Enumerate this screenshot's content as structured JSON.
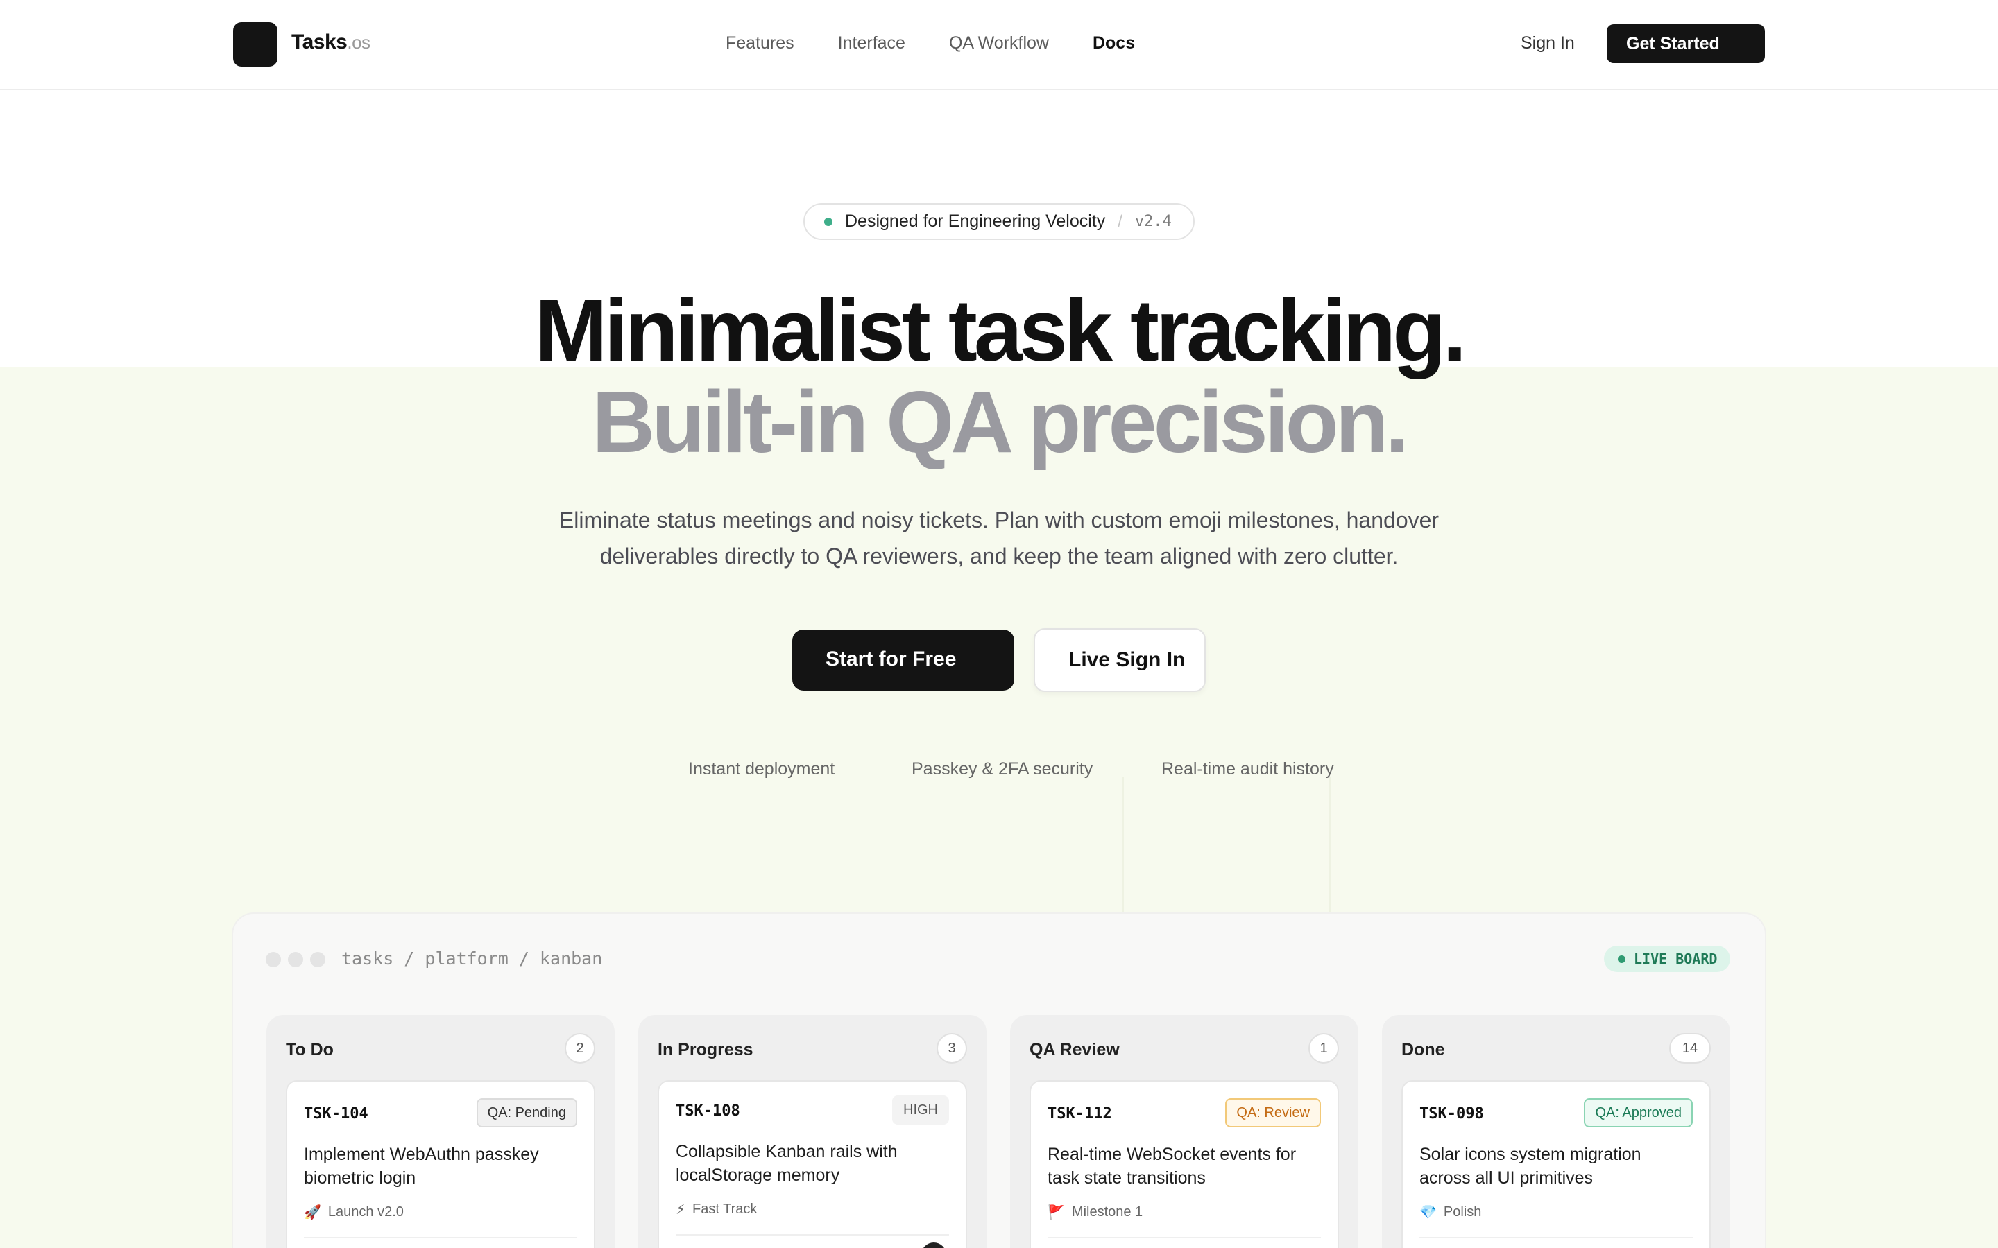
{
  "brand": {
    "name": "Tasks",
    "suffix": ".os"
  },
  "nav": {
    "links": [
      "Features",
      "Interface",
      "QA Workflow",
      "Docs"
    ],
    "active": "Docs",
    "signin": "Sign In",
    "cta": "Get Started"
  },
  "hero": {
    "pill_label": "Designed for Engineering Velocity",
    "pill_separator": "/",
    "pill_version": "v2.4",
    "headline_1": "Minimalist task tracking.",
    "headline_2": "Built-in QA precision.",
    "subtitle": "Eliminate status meetings and noisy tickets. Plan with custom emoji milestones, handover deliverables directly to QA reviewers, and keep the team aligned with zero clutter.",
    "primary_cta": "Start for Free",
    "secondary_cta": "Live Sign In",
    "features": [
      "Instant deployment",
      "Passkey & 2FA security",
      "Real-time audit history"
    ]
  },
  "board": {
    "path": "tasks / platform / kanban",
    "live_label": "LIVE BOARD",
    "columns": [
      {
        "title": "To Do",
        "count": "2",
        "card": {
          "id": "TSK-104",
          "badge": "QA: Pending",
          "badge_style": "pending",
          "title": "Implement WebAuthn passkey biometric login",
          "tag_icon": "🚀",
          "tag": "Launch v2.0"
        }
      },
      {
        "title": "In Progress",
        "count": "3",
        "card": {
          "id": "TSK-108",
          "badge": "HIGH",
          "badge_style": "high",
          "title": "Collapsible Kanban rails with localStorage memory",
          "tag_icon": "⚡",
          "tag": "Fast Track"
        }
      },
      {
        "title": "QA Review",
        "count": "1",
        "card": {
          "id": "TSK-112",
          "badge": "QA: Review",
          "badge_style": "review",
          "title": "Real-time WebSocket events for task state transitions",
          "tag_icon": "🚩",
          "tag": "Milestone 1"
        }
      },
      {
        "title": "Done",
        "count": "14",
        "card": {
          "id": "TSK-098",
          "badge": "QA: Approved",
          "badge_style": "approved",
          "title": "Solar icons system migration across all UI primitives",
          "tag_icon": "💎",
          "tag": "Polish"
        }
      }
    ]
  },
  "colors": {
    "accent_dark": "#141414",
    "green": "#3fae8a",
    "tint": "#f7faee"
  }
}
